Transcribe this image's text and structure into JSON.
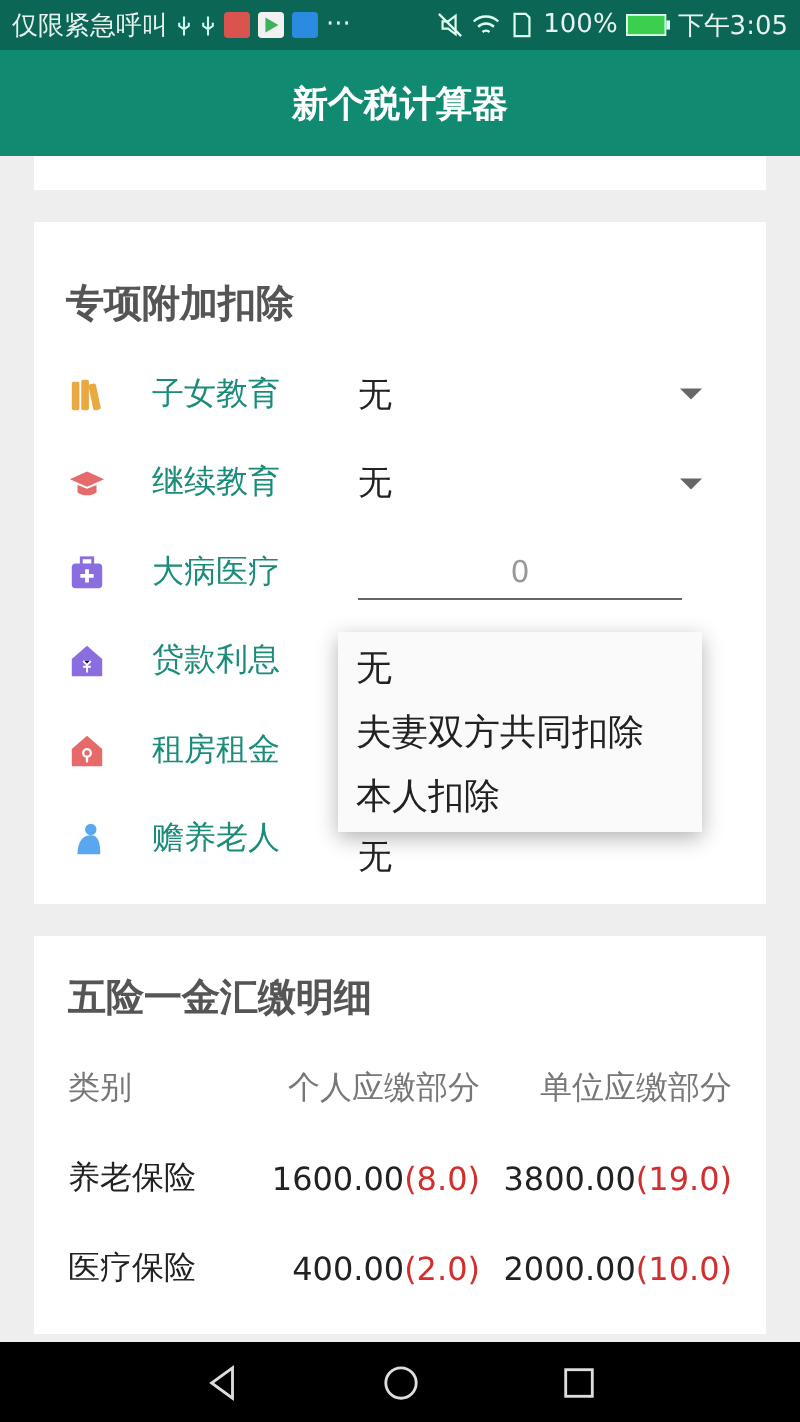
{
  "status_bar": {
    "carrier": "仅限紧急呼叫",
    "more": "···",
    "battery": "100%",
    "time": "下午3:05"
  },
  "app_bar": {
    "title": "新个税计算器"
  },
  "deductions": {
    "title": "专项附加扣除",
    "items": [
      {
        "kind": "select",
        "label": "子女教育",
        "value": "无"
      },
      {
        "kind": "select",
        "label": "继续教育",
        "value": "无"
      },
      {
        "kind": "input",
        "label": "大病医疗",
        "placeholder": "0"
      },
      {
        "kind": "covered",
        "label": "贷款利息"
      },
      {
        "kind": "covered",
        "label": "租房租金"
      },
      {
        "kind": "plain",
        "label": "赡养老人",
        "value": "无"
      }
    ],
    "popup": {
      "options": [
        {
          "label": "无",
          "selected": false
        },
        {
          "label": "夫妻双方共同扣除",
          "selected": false
        },
        {
          "label": "本人扣除",
          "selected": false
        }
      ]
    }
  },
  "insurance": {
    "title": "五险一金汇缴明细",
    "columns": [
      "类别",
      "个人应缴部分",
      "单位应缴部分"
    ],
    "rows": [
      {
        "name": "养老保险",
        "personal": "1600.00",
        "personal_rate": "(8.0)",
        "company": "3800.00",
        "company_rate": "(19.0)"
      },
      {
        "name": "医疗保险",
        "personal": "400.00",
        "personal_rate": "(2.0)",
        "company": "2000.00",
        "company_rate": "(10.0)"
      }
    ]
  }
}
